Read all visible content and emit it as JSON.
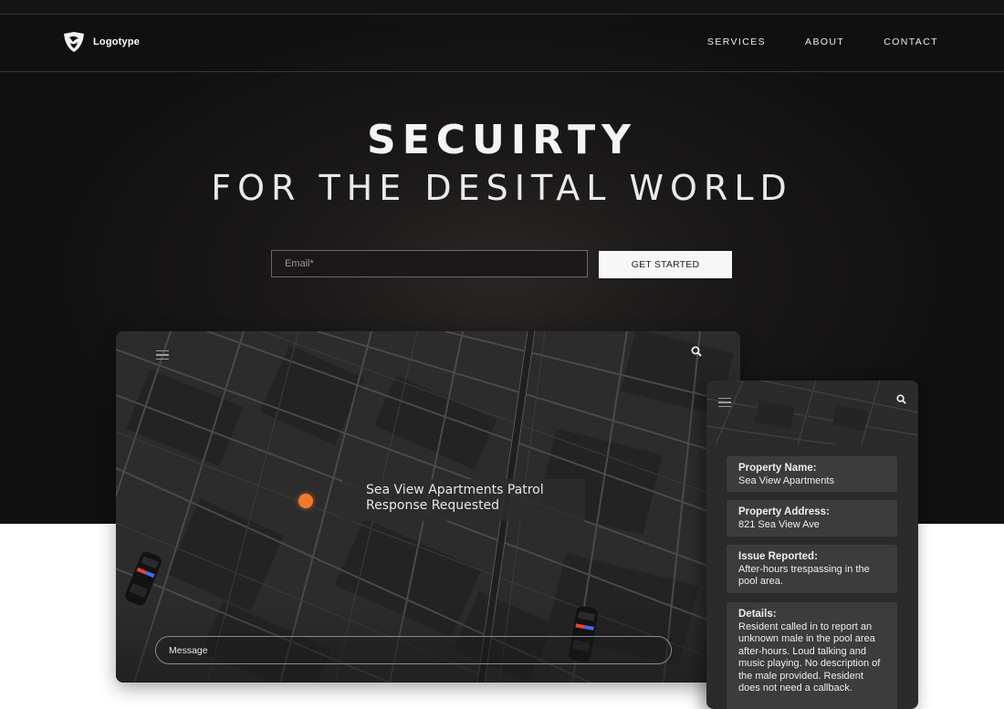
{
  "nav": {
    "logo_text": "Logotype",
    "links": [
      "SERVICES",
      "ABOUT",
      "CONTACT"
    ]
  },
  "hero": {
    "title": "SECUIRTY",
    "subtitle": "FOR THE DESITAL WORLD",
    "email_placeholder": "Email*",
    "cta_label": "GET STARTED"
  },
  "desktop_app": {
    "callout_line1": "Sea View Apartments Patrol",
    "callout_line2": "Response Requested",
    "message_placeholder": "Message",
    "icons": [
      "hamburger-menu-icon",
      "search-icon",
      "location-pin-icon",
      "police-car-icon"
    ]
  },
  "mobile_app": {
    "cards": [
      {
        "label": "Property Name:",
        "value": "Sea View Apartments"
      },
      {
        "label": "Property Address:",
        "value": "821 Sea View Ave"
      },
      {
        "label": "Issue Reported:",
        "value": "After-hours trespassing in the pool area."
      },
      {
        "label": "Details:",
        "value": "Resident called in to report an unknown male in the pool area after-hours. Loud talking and music playing. No description of the male provided. Resident does not need a callback."
      }
    ]
  },
  "colors": {
    "hero_bg": "#151414",
    "accent_pin": "#f07a2b",
    "card_bg": "#2b2b2b",
    "info_card_bg": "#3c3c3c"
  }
}
